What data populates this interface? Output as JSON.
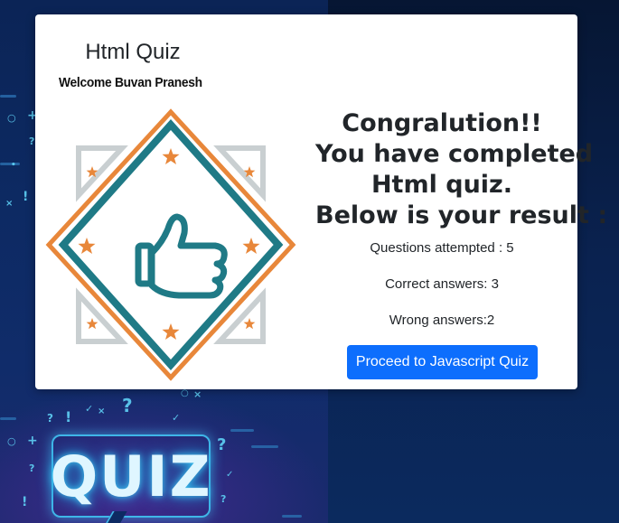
{
  "card": {
    "quiz_title": "Html Quiz",
    "welcome": "Welcome Buvan Pranesh",
    "badge_icon": "thumbs-up-badge-icon"
  },
  "result": {
    "heading_lines": [
      "Congralution!!",
      "You have completed",
      "Html quiz.",
      "Below is your result :"
    ],
    "attempted_label": "Questions attempted : 5",
    "correct_label": "Correct answers: 3",
    "wrong_label": "Wrong answers:2",
    "proceed_button": "Proceed to Javascript Quiz"
  },
  "background": {
    "sign_text": "QUIZ"
  },
  "colors": {
    "primary_button": "#0d6efd",
    "badge_orange": "#e8873a",
    "badge_teal": "#1f7a86",
    "badge_gray": "#c9cfd1"
  }
}
